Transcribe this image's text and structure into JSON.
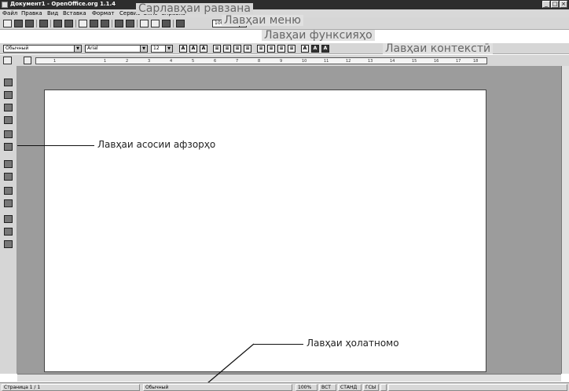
{
  "window": {
    "title": "Документ1 - OpenOffice.org 1.1.4",
    "controls": [
      "_",
      "□",
      "×"
    ]
  },
  "menu": {
    "items": [
      "Файл",
      "Правка",
      "Вид",
      "Вставка",
      "Формат",
      "Сервис",
      "Окно",
      "Справка"
    ]
  },
  "toolbar": {
    "zoom": "100%"
  },
  "objectbar": {
    "style": "Обычный",
    "font": "Arial",
    "size": "12",
    "effects": [
      "A",
      "A",
      "A"
    ],
    "colors": [
      "A",
      "A",
      "A"
    ]
  },
  "ruler": {
    "labels": [
      "1",
      "1",
      "2",
      "3",
      "4",
      "5",
      "6",
      "7",
      "8",
      "9",
      "10",
      "11",
      "12",
      "13",
      "14",
      "15",
      "16",
      "17",
      "18"
    ]
  },
  "callouts": {
    "title_bar": "Сарлавҳаи равзана",
    "menu_bar": "Лавҳаи меню",
    "function_bar": "Лавҳаи функсияҳо",
    "object_bar": "Лавҳаи контекстӣ",
    "main_toolbar": "Лавҳаи асосии афзорҳо",
    "status_bar": "Лавҳаи ҳолатномо"
  },
  "status": {
    "page": "Страница 1 / 1",
    "style": "Обычный",
    "zoom": "100%",
    "insert": "ВСТ",
    "mode": "СТАНД",
    "hyperlink": "ГСЫ"
  }
}
